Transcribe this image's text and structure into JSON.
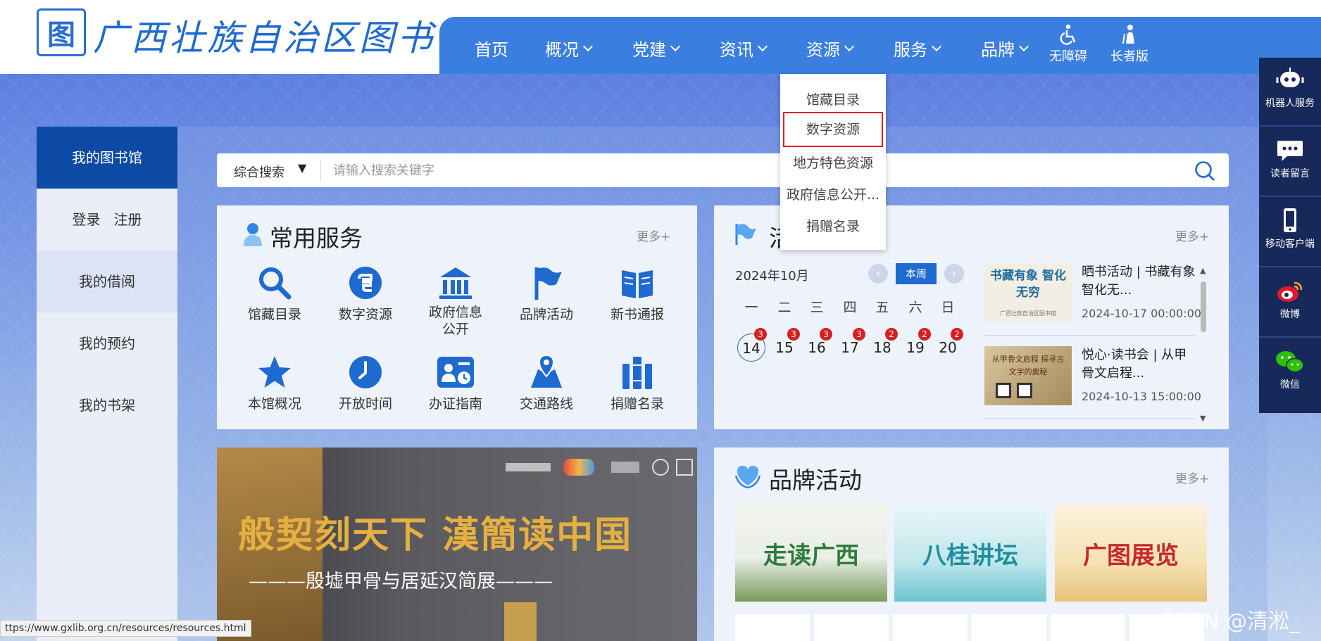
{
  "site": {
    "seal": "图",
    "title": "广西壮族自治区图书馆"
  },
  "nav": {
    "items": [
      {
        "label": "首页",
        "has_dropdown": false
      },
      {
        "label": "概况",
        "has_dropdown": true
      },
      {
        "label": "党建",
        "has_dropdown": true
      },
      {
        "label": "资讯",
        "has_dropdown": true
      },
      {
        "label": "资源",
        "has_dropdown": true
      },
      {
        "label": "服务",
        "has_dropdown": true
      },
      {
        "label": "品牌",
        "has_dropdown": true
      }
    ],
    "accessibility_label": "无障碍",
    "elder_label": "长者版"
  },
  "resources_menu": {
    "items": [
      "馆藏目录",
      "数字资源",
      "地方特色资源",
      "政府信息公开...",
      "捐赠名录"
    ],
    "highlighted": "数字资源"
  },
  "sidebar": {
    "header": "我的图书馆",
    "login": "登录",
    "register": "注册",
    "items": [
      "我的借阅",
      "我的预约",
      "我的书架"
    ]
  },
  "search": {
    "scope": "综合搜索",
    "placeholder": "请输入搜索关键字",
    "value": ""
  },
  "services": {
    "title": "常用服务",
    "more": "更多+",
    "items": [
      {
        "label": "馆藏目录",
        "icon": "search-icon"
      },
      {
        "label": "数字资源",
        "icon": "e-resource-icon"
      },
      {
        "label": "政府信息公开",
        "icon": "government-building-icon"
      },
      {
        "label": "品牌活动",
        "icon": "flag-icon"
      },
      {
        "label": "新书通报",
        "icon": "open-book-icon"
      },
      {
        "label": "本馆概况",
        "icon": "star-icon"
      },
      {
        "label": "开放时间",
        "icon": "clock-icon"
      },
      {
        "label": "办证指南",
        "icon": "id-card-icon"
      },
      {
        "label": "交通路线",
        "icon": "map-pin-icon"
      },
      {
        "label": "捐赠名录",
        "icon": "books-icon"
      }
    ]
  },
  "activities": {
    "title": "活",
    "more": "更多+",
    "month": "2024年10月",
    "week_button": "本周",
    "weekdays": [
      "一",
      "二",
      "三",
      "四",
      "五",
      "六",
      "日"
    ],
    "days": [
      {
        "day": "14",
        "count": "3",
        "today": true
      },
      {
        "day": "15",
        "count": "3",
        "today": false
      },
      {
        "day": "16",
        "count": "3",
        "today": false
      },
      {
        "day": "17",
        "count": "3",
        "today": false
      },
      {
        "day": "18",
        "count": "2",
        "today": false
      },
      {
        "day": "19",
        "count": "2",
        "today": false
      },
      {
        "day": "20",
        "count": "2",
        "today": false
      }
    ],
    "list": [
      {
        "title": "晒书活动 | 书藏有象 智化无...",
        "time": "2024-10-17 00:00:00",
        "image_text": "书藏有象 智化无穷",
        "image_caption": "广西壮族自治区图书馆"
      },
      {
        "title": "悦心·读书会 | 从甲骨文启程...",
        "time": "2024-10-13 15:00:00",
        "image_text": "从甲骨文启程 探寻古文字的奥秘"
      }
    ]
  },
  "banner": {
    "headline": "般契刻天下 漢簡读中国",
    "subtitle": "———殷墟甲骨与居延汉简展———"
  },
  "brand": {
    "title": "品牌活动",
    "more": "更多+",
    "items": [
      {
        "label": "走读广西",
        "color": "#2f7a3a"
      },
      {
        "label": "八桂讲坛",
        "color": "#1f8ea0"
      },
      {
        "label": "广图展览",
        "color": "#c8282e"
      }
    ]
  },
  "float_bar": {
    "items": [
      {
        "label": "机器人服务",
        "icon": "robot-icon"
      },
      {
        "label": "读者留言",
        "icon": "chat-bubble-icon"
      },
      {
        "label": "移动客户端",
        "icon": "mobile-phone-icon"
      },
      {
        "label": "微博",
        "icon": "weibo-icon"
      },
      {
        "label": "微信",
        "icon": "wechat-icon"
      }
    ]
  },
  "status_url": "ttps://www.gxlib.org.cn/resources/resources.html",
  "watermark": "CSDN @清淞_",
  "colors": {
    "nav": "#3a7ee0",
    "accent": "#1e6ad0",
    "sidebar_head": "#0c4aa6",
    "badge": "#d61f1f",
    "highlight_border": "#dd2222"
  }
}
